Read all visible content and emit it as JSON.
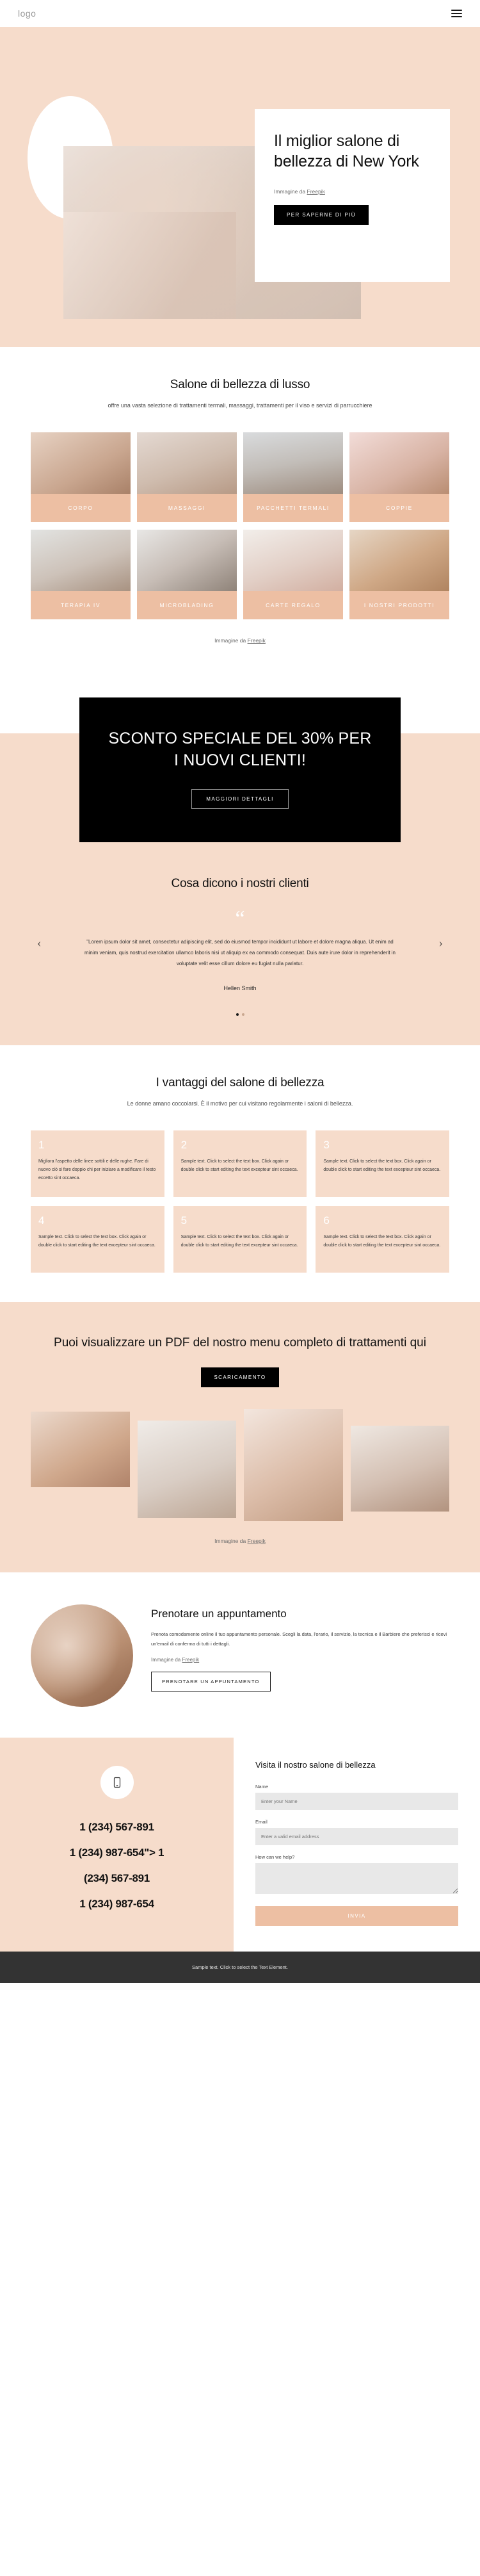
{
  "header": {
    "logo": "logo",
    "menu_icon": "hamburger-menu-icon"
  },
  "hero": {
    "title": "Il miglior salone di bellezza di New York",
    "credit_prefix": "Immagine da ",
    "credit_link": "Freepik",
    "cta": "PER SAPERNE DI PIÙ"
  },
  "services": {
    "title": "Salone di bellezza di lusso",
    "subtitle": "offre una vasta selezione di trattamenti termali, massaggi, trattamenti per il viso e servizi di parrucchiere",
    "credit_prefix": "Immagine da ",
    "credit_link": "Freepik",
    "cards": [
      {
        "label": "CORPO"
      },
      {
        "label": "MASSAGGI"
      },
      {
        "label": "PACCHETTI TERMALI"
      },
      {
        "label": "COPPIE"
      },
      {
        "label": "TERAPIA IV"
      },
      {
        "label": "MICROBLADING"
      },
      {
        "label": "CARTE REGALO"
      },
      {
        "label": "I NOSTRI PRODOTTI"
      }
    ]
  },
  "discount": {
    "title": "SCONTO SPECIALE DEL 30% PER I NUOVI CLIENTI!",
    "cta": "MAGGIORI DETTAGLI"
  },
  "testimonials": {
    "title": "Cosa dicono i nostri clienti",
    "quote_glyph": "“",
    "body": "\"Lorem ipsum dolor sit amet, consectetur adipiscing elit, sed do eiusmod tempor incididunt ut labore et dolore magna aliqua. Ut enim ad minim veniam, quis nostrud exercitation ullamco laboris nisi ut aliquip ex ea commodo consequat. Duis aute irure dolor in reprehenderit in voluptate velit esse cillum dolore eu fugiat nulla pariatur.",
    "author": "Hellen Smith",
    "prev": "‹",
    "next": "›"
  },
  "benefits": {
    "title": "I vantaggi del salone di bellezza",
    "subtitle": "Le donne amano coccolarsi. È il motivo per cui visitano regolarmente i saloni di bellezza.",
    "items": [
      {
        "num": "1",
        "text": "Migliora l'aspetto delle linee sottili e delle rughe. Fare di nuovo ciò si fare doppio chi per iniziare a modificare il testo eccetto sint occaeca."
      },
      {
        "num": "2",
        "text": "Sample text. Click to select the text box. Click again or double click to start editing the text excepteur sint occaeca."
      },
      {
        "num": "3",
        "text": "Sample text. Click to select the text box. Click again or double click to start editing the text excepteur sint occaeca."
      },
      {
        "num": "4",
        "text": "Sample text. Click to select the text box. Click again or double click to start editing the text excepteur sint occaeca."
      },
      {
        "num": "5",
        "text": "Sample text. Click to select the text box. Click again or double click to start editing the text excepteur sint occaeca."
      },
      {
        "num": "6",
        "text": "Sample text. Click to select the text box. Click again or double click to start editing the text excepteur sint occaeca."
      }
    ]
  },
  "pdf": {
    "title": "Puoi visualizzare un PDF del nostro menu completo di trattamenti qui",
    "cta": "SCARICAMENTO",
    "credit_prefix": "Immagine da ",
    "credit_link": "Freepik"
  },
  "appointment": {
    "title": "Prenotare un appuntamento",
    "body": "Prenota comodamente online il tuo appuntamento personale. Scegli la data, l'orario, il servizio, la tecnica e il Barbiere che preferisci e ricevi un'email di conferma di tutti i dettagli.",
    "credit_prefix": "Immagine da ",
    "credit_link": "Freepik",
    "cta": "PRENOTARE UN APPUNTAMENTO"
  },
  "contact": {
    "icon": "phone-icon",
    "phones": [
      "1 (234) 567-891",
      "1 (234) 987-654\"> 1",
      "(234) 567-891",
      "1 (234) 987-654"
    ],
    "form_title": "Visita il nostro salone di bellezza",
    "name_label": "Name",
    "name_placeholder": "Enter your Name",
    "email_label": "Email",
    "email_placeholder": "Enter a valid email address",
    "message_label": "How can we help?",
    "message_placeholder": "",
    "submit": "INVIA"
  },
  "footer": {
    "text": "Sample text. Click to select the Text Element."
  },
  "colors": {
    "peach": "#f6dccb",
    "accent": "#edbfa3",
    "dark": "#000000",
    "footer": "#333333"
  }
}
